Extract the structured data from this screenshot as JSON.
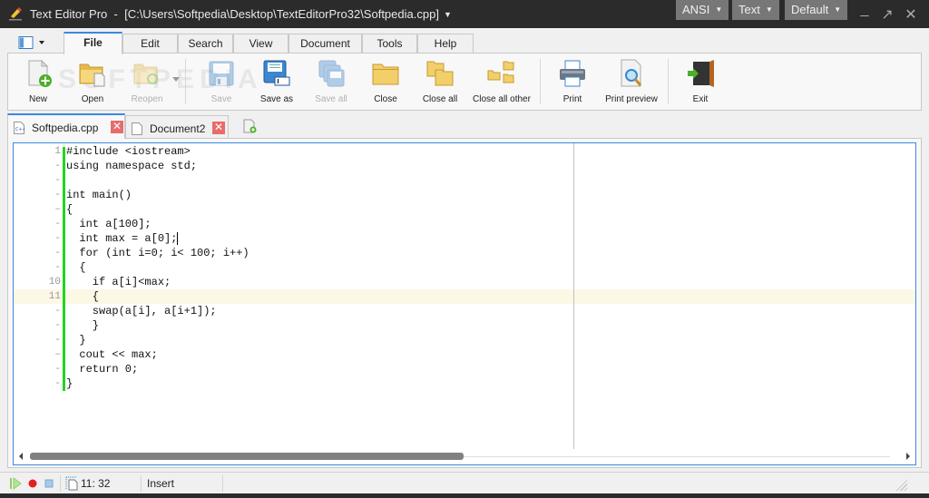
{
  "titlebar": {
    "app_name": "Text Editor Pro",
    "separator": "-",
    "file_path": "[C:\\Users\\Softpedia\\Desktop\\TextEditorPro32\\Softpedia.cpp]",
    "encoding": "ANSI",
    "highlighter": "Text",
    "style": "Default",
    "minimize": "_",
    "restore": "↗",
    "close": "✕"
  },
  "menu": {
    "tabs": [
      {
        "label": "File",
        "active": true
      },
      {
        "label": "Edit"
      },
      {
        "label": "Search"
      },
      {
        "label": "View"
      },
      {
        "label": "Document"
      },
      {
        "label": "Tools"
      },
      {
        "label": "Help"
      }
    ]
  },
  "ribbon": {
    "watermark": "SOFTPEDIA",
    "buttons": [
      {
        "label": "New",
        "icon": "new-file-icon",
        "enabled": true
      },
      {
        "label": "Open",
        "icon": "open-folder-icon",
        "enabled": true
      },
      {
        "label": "Reopen",
        "icon": "reopen-folder-icon",
        "enabled": false
      },
      {
        "label": "Save",
        "icon": "save-icon",
        "enabled": false
      },
      {
        "label": "Save as",
        "icon": "save-as-icon",
        "enabled": true
      },
      {
        "label": "Save all",
        "icon": "save-all-icon",
        "enabled": false
      },
      {
        "label": "Close",
        "icon": "close-folder-icon",
        "enabled": true
      },
      {
        "label": "Close all",
        "icon": "close-all-icon",
        "enabled": true
      },
      {
        "label": "Close all other",
        "icon": "close-all-other-icon",
        "enabled": true
      },
      {
        "label": "Print",
        "icon": "printer-icon",
        "enabled": true
      },
      {
        "label": "Print preview",
        "icon": "print-preview-icon",
        "enabled": true
      },
      {
        "label": "Exit",
        "icon": "exit-door-icon",
        "enabled": true
      }
    ]
  },
  "doc_tabs": [
    {
      "label": "Softpedia.cpp",
      "active": true,
      "icon": "cpp-file-icon"
    },
    {
      "label": "Document2",
      "active": false,
      "icon": "text-file-icon"
    }
  ],
  "close_glyph": "✕",
  "editor": {
    "line_markers": [
      "1",
      "-",
      "-",
      "-",
      "–",
      "-",
      "-",
      "-",
      "-",
      "10",
      "11",
      "-",
      "-",
      "-",
      "–",
      "-",
      "-"
    ],
    "lines": [
      "#include <iostream>",
      "using namespace std;",
      "",
      "int main()",
      "{",
      "  int a[100];",
      "  int max = a[0];",
      "  for (int i=0; i< 100; i++)",
      "  {",
      "    if a[i]<max;",
      "    {",
      "    swap(a[i], a[i+1]);",
      "    }",
      "  }",
      "  cout << max;",
      "  return 0;",
      "}"
    ],
    "current_line": 11,
    "cursor_line": 7,
    "horizontal_scroll_fraction": 0.49
  },
  "status": {
    "position": "11: 32",
    "mode": "Insert"
  }
}
